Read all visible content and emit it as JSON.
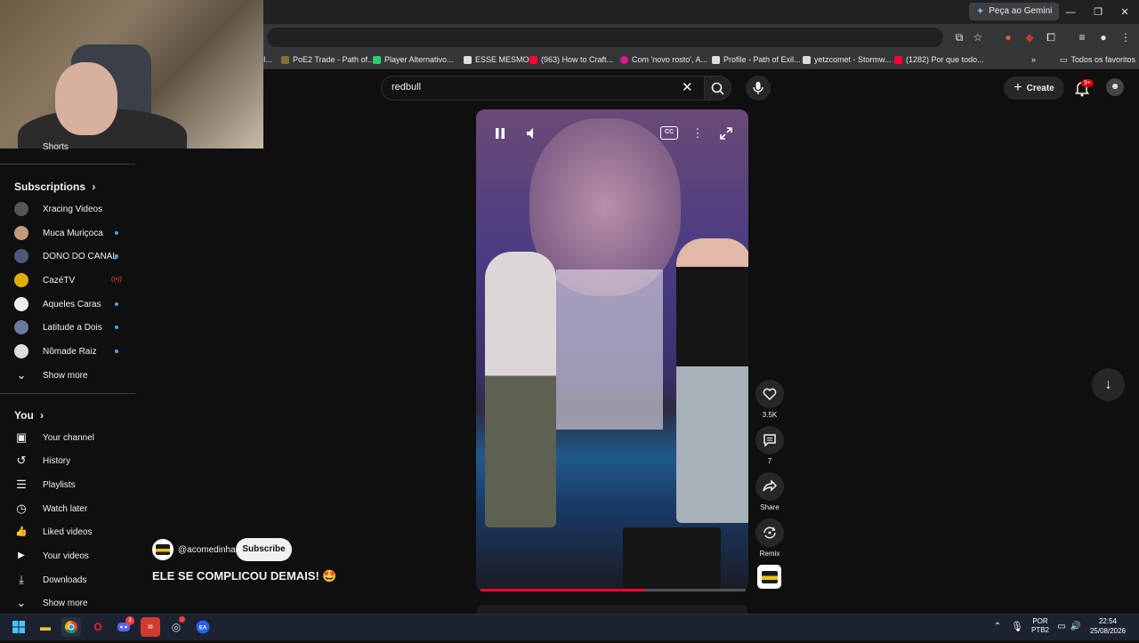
{
  "browser": {
    "gemini_label": "Peça ao Gemini",
    "window_controls": {
      "minimize": "—",
      "restore": "❐",
      "close": "✕"
    },
    "bookmarks": [
      {
        "label": "I..."
      },
      {
        "label": "PoE2 Trade - Path of..."
      },
      {
        "label": "Player Alternativo..."
      },
      {
        "label": "ESSE MESMO"
      },
      {
        "label": "(963) How to Craft..."
      },
      {
        "label": "Com 'novo rosto', A..."
      },
      {
        "label": "Profile - Path of Exil..."
      },
      {
        "label": "yetzcomet - Stormw..."
      },
      {
        "label": "(1282) Por que todo..."
      }
    ],
    "more_bookmarks": "»",
    "all_bookmarks": "Todos os favoritos"
  },
  "youtube": {
    "search_value": "redbull",
    "create_label": "Create",
    "notif_badge": "9+",
    "sidebar": {
      "shorts_label": "Shorts",
      "subscriptions_heading": "Subscriptions",
      "subscriptions": [
        {
          "name": "Xracing Videos",
          "indicator": "none",
          "color": "#555"
        },
        {
          "name": "Muca Muriçoca",
          "indicator": "dot",
          "color": "#c49a7a"
        },
        {
          "name": "DONO DO CANAL",
          "indicator": "dot",
          "color": "#4a5a7a"
        },
        {
          "name": "CazéTV",
          "indicator": "live",
          "color": "#e0b000"
        },
        {
          "name": "Aqueles Caras",
          "indicator": "dot",
          "color": "#eeeeee"
        },
        {
          "name": "Latitude a Dois",
          "indicator": "dot",
          "color": "#6a7a9a"
        },
        {
          "name": "Nômade Raiz",
          "indicator": "dot",
          "color": "#dddddd"
        }
      ],
      "live_symbol": "((•))",
      "show_more_1": "Show more",
      "you_heading": "You",
      "you_items": [
        {
          "label": "Your channel",
          "icon": "▣"
        },
        {
          "label": "History",
          "icon": "↺"
        },
        {
          "label": "Playlists",
          "icon": "☰"
        },
        {
          "label": "Watch later",
          "icon": "◷"
        },
        {
          "label": "Liked videos",
          "icon": "👍"
        },
        {
          "label": "Your videos",
          "icon": "▶"
        },
        {
          "label": "Downloads",
          "icon": "⤓"
        }
      ],
      "show_more_2": "Show more"
    },
    "short": {
      "channel_handle": "@acomedinha",
      "subscribe_label": "Subscribe",
      "title": "ELE SE COMPLICOU DEMAIS! 🤩",
      "progress": 0.62,
      "actions": {
        "likes": "3.5K",
        "comments": "7",
        "share": "Share",
        "remix": "Remix"
      },
      "cc_label": "CC"
    }
  },
  "taskbar": {
    "lang_line1": "POR",
    "lang_line2": "PTB2",
    "time": "22:54",
    "date": "25/08/2026",
    "discord_badge": "3"
  }
}
